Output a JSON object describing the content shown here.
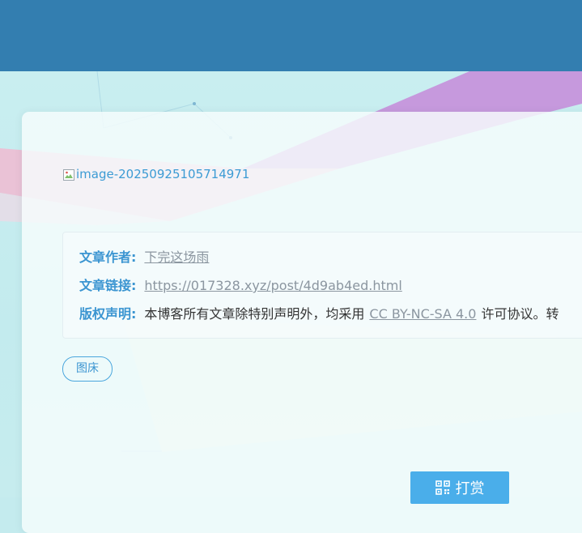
{
  "image": {
    "alt": "image-20250925105714971"
  },
  "copyright": {
    "author_label": "文章作者:",
    "author_value": "下完这场雨",
    "link_label": "文章链接:",
    "link_value": "https://017328.xyz/post/4d9ab4ed.html",
    "license_label": "版权声明:",
    "license_prefix": "本博客所有文章除特别声明外，均采用",
    "license_name": "CC BY-NC-SA 4.0",
    "license_suffix": "许可协议。转"
  },
  "tags": [
    "图床"
  ],
  "reward": {
    "label": "打赏",
    "icon": "qrcode-icon"
  },
  "colors": {
    "header": "#337eb0",
    "accent": "#3b95d1",
    "button": "#4aaeea"
  }
}
